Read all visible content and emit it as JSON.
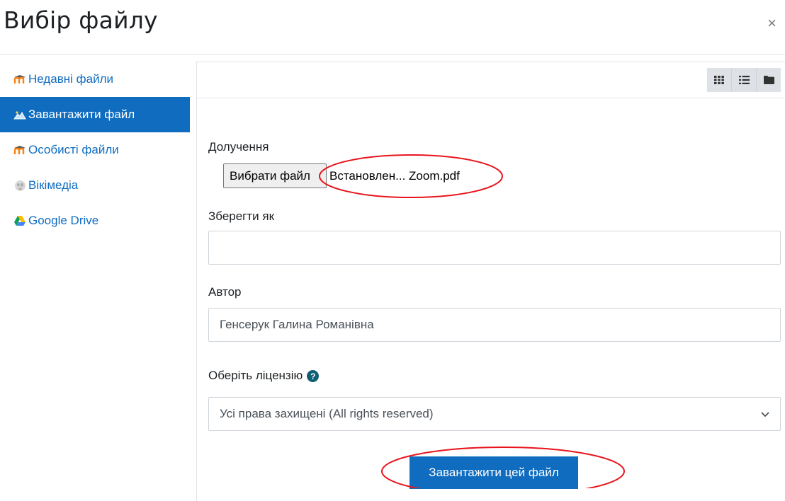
{
  "dialog": {
    "title": "Вибір файлу",
    "close_symbol": "×"
  },
  "sidebar": {
    "items": [
      {
        "label": "Недавні файли",
        "icon": "moodle-icon",
        "active": false
      },
      {
        "label": "Завантажити файл",
        "icon": "upload-icon",
        "active": true
      },
      {
        "label": "Особисті файли",
        "icon": "moodle-icon",
        "active": false
      },
      {
        "label": "Вікімедіа",
        "icon": "wikimedia-icon",
        "active": false
      },
      {
        "label": "Google Drive",
        "icon": "google-drive-icon",
        "active": false
      }
    ]
  },
  "toolbar": {
    "views": [
      "grid-view-icon",
      "list-view-icon",
      "folder-view-icon"
    ]
  },
  "form": {
    "attachment_label": "Долучення",
    "choose_button": "Вибрати файл",
    "file_name": "Встановлен... Zoom.pdf",
    "save_as_label": "Зберегти як",
    "save_as_value": "",
    "author_label": "Автор",
    "author_value": "Генсерук Галина Романівна",
    "license_label": "Оберіть ліцензію",
    "license_value": "Усі права захищені (All rights reserved)",
    "upload_button": "Завантажити цей файл"
  },
  "colors": {
    "accent": "#0f6cbf",
    "annotation": "#e8141c"
  }
}
